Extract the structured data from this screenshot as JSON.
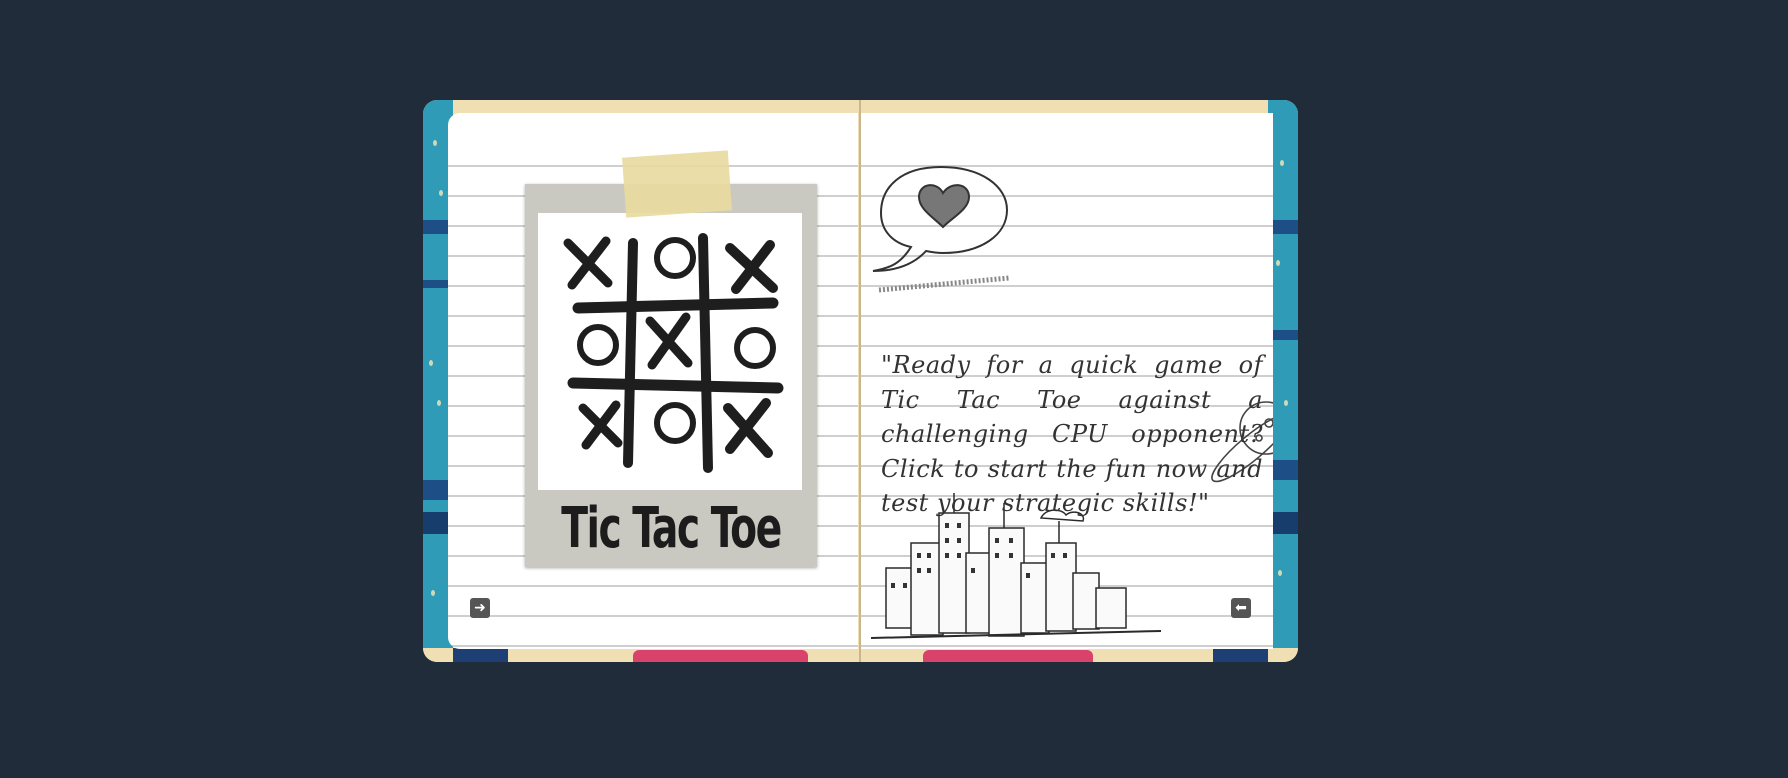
{
  "book": {
    "left_page": {
      "caption": "Tic Tac Toe",
      "next_button_icon": "arrow-right-icon"
    },
    "right_page": {
      "story_text": "\"Ready for a quick game of Tic Tac Toe against a challenging CPU opponent? Click to start the fun now and test your strategic skills!\"",
      "prev_button_icon": "arrow-left-icon"
    }
  },
  "colors": {
    "background": "#202c3a",
    "cover_cream": "#f1dfb4",
    "cover_teal": "#2f9bb7",
    "cover_red": "#d9426a",
    "page": "#ffffff",
    "ruled_line": "#cfcfcf",
    "polaroid_frame": "#c9c9c1",
    "tape": "#e8daa0",
    "nav_button": "#555555"
  }
}
